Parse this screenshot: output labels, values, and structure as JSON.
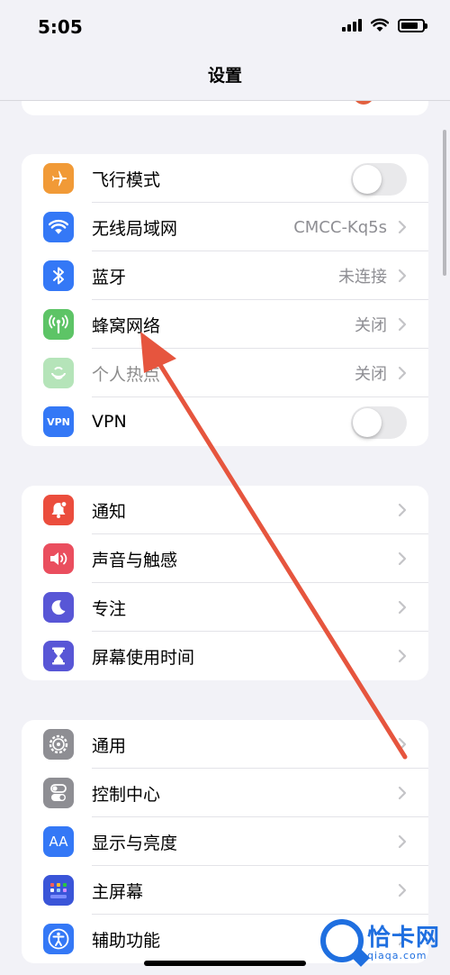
{
  "status_bar": {
    "time": "5:05"
  },
  "nav": {
    "title": "设置"
  },
  "groups": [
    {
      "rows": [
        {
          "label": "飞行模式",
          "value": "",
          "control": "toggle",
          "icon": "airplane-icon",
          "color": "#f19a37"
        },
        {
          "label": "无线局域网",
          "value": "CMCC-Kq5s",
          "control": "chevron",
          "icon": "wifi-icon",
          "color": "#3478f6"
        },
        {
          "label": "蓝牙",
          "value": "未连接",
          "control": "chevron",
          "icon": "bluetooth-icon",
          "color": "#3478f6"
        },
        {
          "label": "蜂窝网络",
          "value": "关闭",
          "control": "chevron",
          "icon": "cellular-icon",
          "color": "#5dc466"
        },
        {
          "label": "个人热点",
          "value": "关闭",
          "control": "chevron",
          "icon": "hotspot-icon",
          "color": "#5dc466",
          "disabled": true
        },
        {
          "label": "VPN",
          "value": "",
          "control": "toggle",
          "icon": "vpn-icon",
          "icon_text": "VPN",
          "color": "#3478f6"
        }
      ]
    },
    {
      "rows": [
        {
          "label": "通知",
          "icon": "bell-icon",
          "color": "#eb4d3d"
        },
        {
          "label": "声音与触感",
          "icon": "speaker-icon",
          "color": "#ea4e5e"
        },
        {
          "label": "专注",
          "icon": "moon-icon",
          "color": "#5856d6"
        },
        {
          "label": "屏幕使用时间",
          "icon": "hourglass-icon",
          "color": "#5856d6"
        }
      ]
    },
    {
      "rows": [
        {
          "label": "通用",
          "icon": "gear-icon",
          "color": "#8e8e93"
        },
        {
          "label": "控制中心",
          "icon": "toggles-icon",
          "color": "#8e8e93"
        },
        {
          "label": "显示与亮度",
          "icon": "text-size-icon",
          "icon_text": "AA",
          "color": "#3478f6"
        },
        {
          "label": "主屏幕",
          "icon": "home-grid-icon",
          "color": "#3a55d8"
        },
        {
          "label": "辅助功能",
          "icon": "accessibility-icon",
          "color": "#3478f6"
        }
      ]
    }
  ],
  "watermark": {
    "name": "恰卡网",
    "url": "qiaqa.com"
  }
}
